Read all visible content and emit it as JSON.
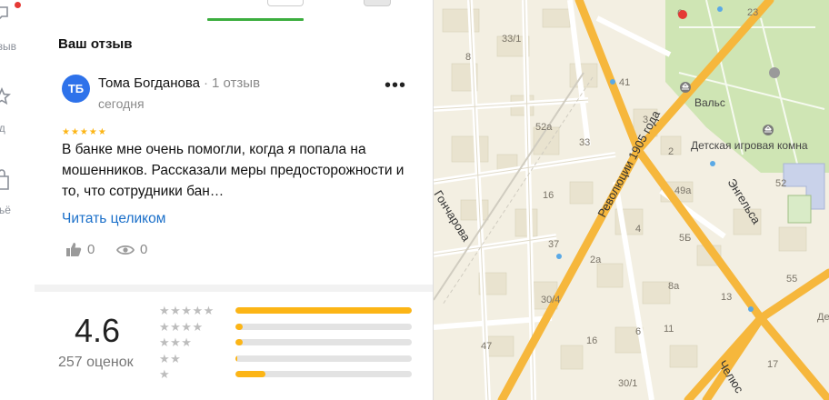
{
  "left_nav": {
    "items": [
      {
        "label": "тзыв"
      },
      {
        "label": "ид"
      },
      {
        "label": "льё"
      }
    ]
  },
  "review": {
    "section_title": "Ваш отзыв",
    "avatar_initials": "ТБ",
    "author_name": "Тома Богданова",
    "author_reviews_count": "1 отзыв",
    "date": "сегодня",
    "rating": 5,
    "rating_stars": "★★★★★",
    "text": "В банке мне очень помогли, когда я попала на мошенников. Рассказали меры предосторожности и то, что сотрудники бан…",
    "read_more_label": "Читать целиком",
    "likes": "0",
    "views": "0"
  },
  "rating_summary": {
    "score": "4.6",
    "count_label": "257 оценок",
    "histogram": [
      {
        "stars": "★★★★★",
        "fraction": 1.0
      },
      {
        "stars": "★★★★",
        "fraction": 0.04
      },
      {
        "stars": "★★★",
        "fraction": 0.04
      },
      {
        "stars": "★★",
        "fraction": 0.01
      },
      {
        "stars": "★",
        "fraction": 0.17
      }
    ]
  },
  "map": {
    "streets": [
      "Революции 1905 года",
      "Энгельса",
      "Гончарова",
      "Челюс"
    ],
    "pois": [
      "Вальс",
      "Детская игровая комна"
    ],
    "labels": [
      "33/1",
      "8",
      "41",
      "52а",
      "33",
      "3",
      "2",
      "49а",
      "16",
      "37",
      "2а",
      "5Б",
      "4",
      "8а",
      "13",
      "55",
      "52",
      "30/4",
      "16",
      "11",
      "6",
      "47",
      "30/1",
      "17",
      "23",
      "6",
      "Де"
    ]
  },
  "colors": {
    "accent_green": "#3cae3f",
    "star": "#fcb516",
    "link": "#1a6fc9",
    "avatar": "#2e72ea",
    "road": "#f6b73c"
  }
}
